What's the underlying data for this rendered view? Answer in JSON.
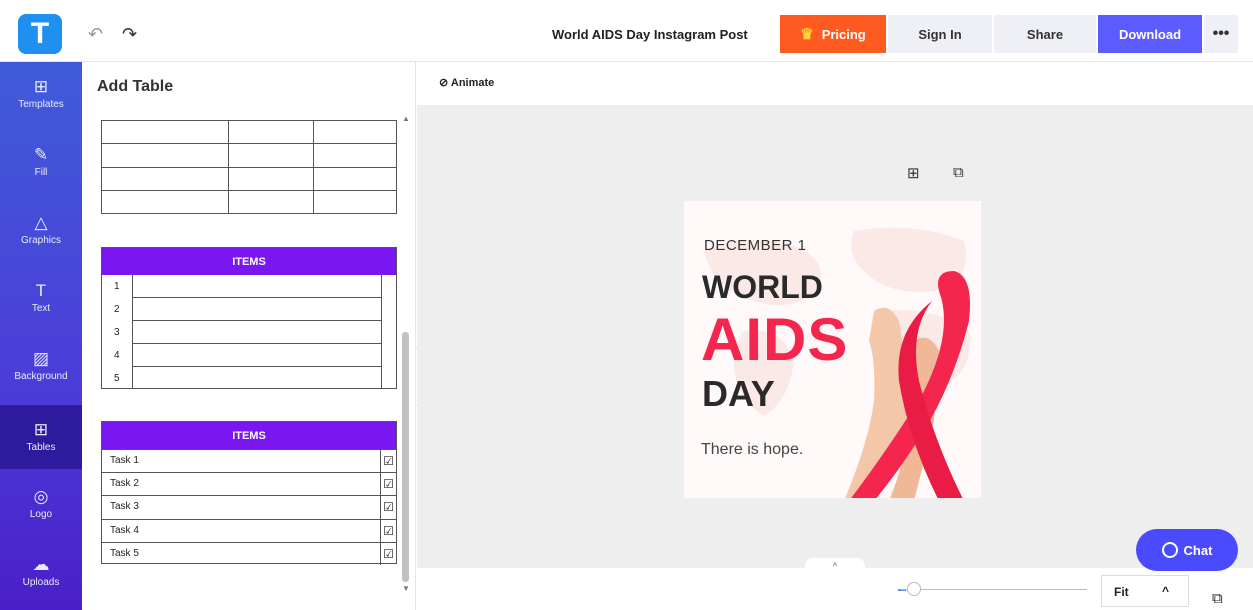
{
  "header": {
    "logo_letter": "T",
    "undo_icon": "↶",
    "redo_icon": "↷",
    "doc_title": "World AIDS Day Instagram Post",
    "pricing_label": "Pricing",
    "signin_label": "Sign In",
    "share_label": "Share",
    "download_label": "Download",
    "more_label": "•••"
  },
  "sidebar": {
    "items": [
      {
        "label": "Templates",
        "icon": "⊞"
      },
      {
        "label": "Fill",
        "icon": "✎"
      },
      {
        "label": "Graphics",
        "icon": "△"
      },
      {
        "label": "Text",
        "icon": "T"
      },
      {
        "label": "Background",
        "icon": "▨"
      },
      {
        "label": "Tables",
        "icon": "⊞"
      },
      {
        "label": "Logo",
        "icon": "◎"
      },
      {
        "label": "Uploads",
        "icon": "☁"
      }
    ],
    "active": "Tables"
  },
  "panel": {
    "title": "Add Table",
    "numbered_table": {
      "header": "ITEMS",
      "rows": [
        "1",
        "2",
        "3",
        "4",
        "5"
      ]
    },
    "checklist_table": {
      "header": "ITEMS",
      "rows": [
        "Task 1",
        "Task 2",
        "Task 3",
        "Task 4",
        "Task 5"
      ],
      "checkbox_icon": "☑"
    }
  },
  "toolbar": {
    "animate_label": "Animate"
  },
  "canvas": {
    "add_icon": "⊞",
    "copy_icon": "⧉"
  },
  "poster": {
    "date": "DECEMBER 1",
    "line1": "WORLD",
    "line2": "AIDS",
    "line3": "DAY",
    "tagline": "There is hope.",
    "accent_color": "#f5264e"
  },
  "bottom": {
    "up_icon": "^",
    "fit_label": "Fit",
    "fit_chevron": "^",
    "pages_icon": "⧉"
  },
  "chat": {
    "label": "Chat"
  },
  "colors": {
    "pricing": "#ff5a1f",
    "download": "#5b5bff",
    "table_header": "#7a17f0",
    "chat": "#4a4aff"
  }
}
